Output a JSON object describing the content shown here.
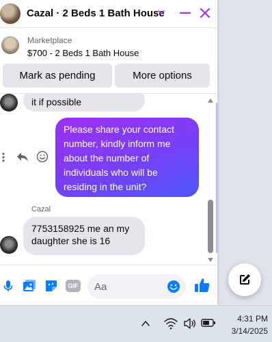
{
  "header": {
    "title": "Cazal · 2 Beds 1 Bath House"
  },
  "listing": {
    "source": "Marketplace",
    "title": "$700 - 2 Beds 1 Bath House"
  },
  "actions": {
    "pending_label": "Mark as pending",
    "more_label": "More options"
  },
  "messages": [
    {
      "direction": "incoming",
      "text": "it if possible"
    },
    {
      "direction": "outgoing",
      "lines": [
        "Please share your contact",
        "number, kindly inform me",
        "about the number of",
        "individuals who will be",
        "residing in the unit?"
      ]
    },
    {
      "direction": "incoming",
      "sender": "Cazal",
      "lines": [
        "7753158925 me an my",
        "daughter she is 16"
      ]
    }
  ],
  "composer": {
    "placeholder": "Aa",
    "gif_label": "GIF"
  },
  "taskbar": {
    "time": "4:31 PM",
    "date": "3/14/2025"
  },
  "colors": {
    "accent": "#a033ff",
    "outgoing_gradient_start": "#9c2ff0",
    "outgoing_gradient_end": "#4c55f7",
    "icon_blue": "#0a7cff"
  }
}
